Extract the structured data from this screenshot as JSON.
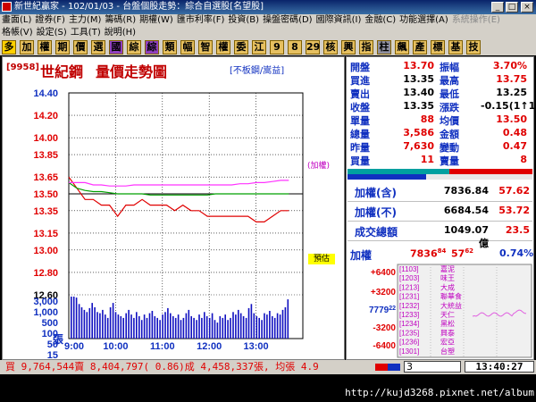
{
  "window": {
    "title": "新世紀贏家 - 102/01/03 - 台盤個股走勢：綜合自選股[名望股]"
  },
  "menu1": [
    "畫面(L)",
    "證券(F)",
    "主力(M)",
    "籌碼(R)",
    "期權(W)",
    "匯市利率(F)",
    "投資(B)",
    "操盤密碼(D)",
    "國際資訊(I)",
    "金融(C)",
    "功能選擇(A)",
    "系統操作(E)"
  ],
  "menu2": [
    "格帳(V)",
    "設定(S)",
    "工具(T)",
    "說明(H)"
  ],
  "toolbar": [
    "多",
    "加",
    "權",
    "期",
    "價",
    "選",
    "國",
    "綜",
    "綜",
    "類",
    "幅",
    "智",
    "權",
    "委",
    "江",
    "9",
    "8",
    "29",
    "核",
    "興",
    "指",
    "柱",
    "飆",
    "產",
    "標",
    "基",
    "技"
  ],
  "chart": {
    "code": "[9958]",
    "name": "世紀鋼",
    "title": "量價走勢圖",
    "subtitle": "[不板鋼/嵩益]",
    "price_ticks": [
      "14.40",
      "14.20",
      "14.00",
      "13.85",
      "13.65",
      "13.50",
      "13.35",
      "13.15",
      "13.00",
      "12.80",
      "12.60"
    ],
    "volume_ticks": [
      "3,000",
      "1,000",
      "500",
      "100",
      "50",
      "15"
    ],
    "volume_unit": "張",
    "time_ticks": [
      "9:00",
      "10:00",
      "11:00",
      "12:00",
      "13:00"
    ],
    "index_label": "(加權)",
    "preview_label": "預估",
    "colors": {
      "price": "#e00000",
      "index": "#ff33ff",
      "avg": "#00a000",
      "volume": "#1010c0",
      "ref": "#000000"
    }
  },
  "chart_data": [
    {
      "type": "line",
      "xlabel": "",
      "ylabel": "",
      "x": [
        "9:00",
        "9:10",
        "9:20",
        "9:30",
        "9:40",
        "9:50",
        "10:00",
        "10:10",
        "10:20",
        "10:30",
        "10:40",
        "10:50",
        "11:00",
        "11:10",
        "11:20",
        "11:30",
        "11:40",
        "11:50",
        "12:00",
        "12:10",
        "12:20",
        "12:30",
        "12:40",
        "12:50",
        "13:00",
        "13:10",
        "13:20",
        "13:30"
      ],
      "series": [
        {
          "values": [
            13.65,
            13.55,
            13.45,
            13.45,
            13.4,
            13.4,
            13.3,
            13.4,
            13.4,
            13.45,
            13.4,
            13.4,
            13.4,
            13.35,
            13.4,
            13.35,
            13.35,
            13.3,
            13.3,
            13.3,
            13.3,
            13.3,
            13.3,
            13.25,
            13.25,
            13.3,
            13.35,
            13.35
          ]
        },
        {
          "values": [
            13.6,
            13.55,
            13.53,
            13.52,
            13.52,
            13.51,
            13.5,
            13.5,
            13.5,
            13.5,
            13.49,
            13.49,
            13.49,
            13.49,
            13.49,
            13.49,
            13.49,
            13.49,
            13.5,
            13.5,
            13.5,
            13.5,
            13.5,
            13.5,
            13.5,
            13.5,
            13.5,
            13.5
          ]
        },
        {
          "values": [
            13.6,
            13.6,
            13.6,
            13.58,
            13.58,
            13.57,
            13.57,
            13.57,
            13.58,
            13.58,
            13.58,
            13.58,
            13.58,
            13.58,
            13.58,
            13.58,
            13.58,
            13.58,
            13.58,
            13.58,
            13.58,
            13.59,
            13.59,
            13.6,
            13.6,
            13.61,
            13.62,
            13.62
          ]
        }
      ],
      "ylim": [
        12.6,
        14.4
      ],
      "reference": 13.5,
      "grid": true
    },
    {
      "type": "bar",
      "xlabel": "",
      "ylabel": "張",
      "y_scale": "log",
      "ylim": [
        1,
        3000
      ],
      "values": [
        60,
        45,
        35,
        20,
        15,
        12,
        10,
        14,
        22,
        15,
        10,
        9,
        12,
        8,
        6,
        15,
        22,
        10,
        8,
        7,
        6,
        9,
        12,
        8,
        6,
        10,
        7,
        5,
        8,
        6,
        9,
        11,
        7,
        6,
        5,
        8,
        10,
        14,
        9,
        7,
        6,
        8,
        5,
        6,
        9,
        12,
        7,
        6,
        5,
        8,
        6,
        10,
        7,
        6,
        9,
        5,
        4,
        7,
        6,
        8,
        5,
        6,
        10,
        8,
        12,
        9,
        7,
        6,
        14,
        20,
        9,
        7,
        6,
        5,
        9,
        8,
        11,
        7,
        6,
        9,
        8,
        12,
        15,
        30
      ]
    }
  ],
  "quote": {
    "rows": [
      {
        "l1": "開盤",
        "v1": "13.70",
        "c1": "red",
        "l2": "振幅",
        "v2": "3.70%",
        "c2": "red"
      },
      {
        "l1": "買進",
        "v1": "13.35",
        "c1": "black",
        "l2": "最高",
        "v2": "13.75",
        "c2": "red"
      },
      {
        "l1": "賣出",
        "v1": "13.40",
        "c1": "black",
        "l2": "最低",
        "v2": "13.25",
        "c2": "black"
      },
      {
        "l1": "收盤",
        "v1": "13.35",
        "c1": "black",
        "l2": "漲跌",
        "v2": "-0.15(1↑1)",
        "c2": "black"
      },
      {
        "l1": "單量",
        "v1": "88",
        "c1": "red",
        "l2": "均價",
        "v2": "13.50",
        "c2": "red"
      },
      {
        "l1": "總量",
        "v1": "3,586",
        "c1": "red",
        "l2": "金額",
        "v2": "0.48",
        "c2": "red"
      },
      {
        "l1": "昨量",
        "v1": "7,630",
        "c1": "red",
        "l2": "變動",
        "v2": "0.47",
        "c2": "red"
      },
      {
        "l1": "買量",
        "v1": "11",
        "c1": "red",
        "l2": "賣量",
        "v2": "8",
        "c2": "red"
      }
    ],
    "buy_sell_ratio": 0.55
  },
  "index_box": {
    "rows": [
      {
        "label": "加權(含)",
        "value": "7836.84",
        "change": "57.62"
      },
      {
        "label": "加權(不)",
        "value": "6684.54",
        "change": "53.72"
      },
      {
        "label": "成交總額",
        "value": "1049.07億",
        "change": "23.5"
      }
    ]
  },
  "mini": {
    "label": "加權",
    "value_main": "7836",
    "value_sup": "84",
    "change_main": "57",
    "change_sup": "62",
    "percent": "0.74%",
    "yticks": [
      "+6400",
      "+3200",
      "7779",
      "-3200",
      "-6400"
    ],
    "ytick_sup": "22",
    "codes": [
      "[1103]",
      "[1203]",
      "[1213]",
      "[1231]",
      "[1232]",
      "[1233]",
      "[1234]",
      "[1235]",
      "[1236]",
      "[1301]"
    ],
    "names": [
      "嘉泥",
      "味王",
      "大成",
      "聯華食",
      "大統益",
      "天仁",
      "黑松",
      "興泰",
      "宏亞",
      "台塑"
    ]
  },
  "status": {
    "left": "買 9,764,544賣 8,404,797( 0.86)成 4,458,337張, 均張 4.9",
    "input_value": "3",
    "time": "13:40:27"
  },
  "watermark": "http://kujd3268.pixnet.net/album"
}
